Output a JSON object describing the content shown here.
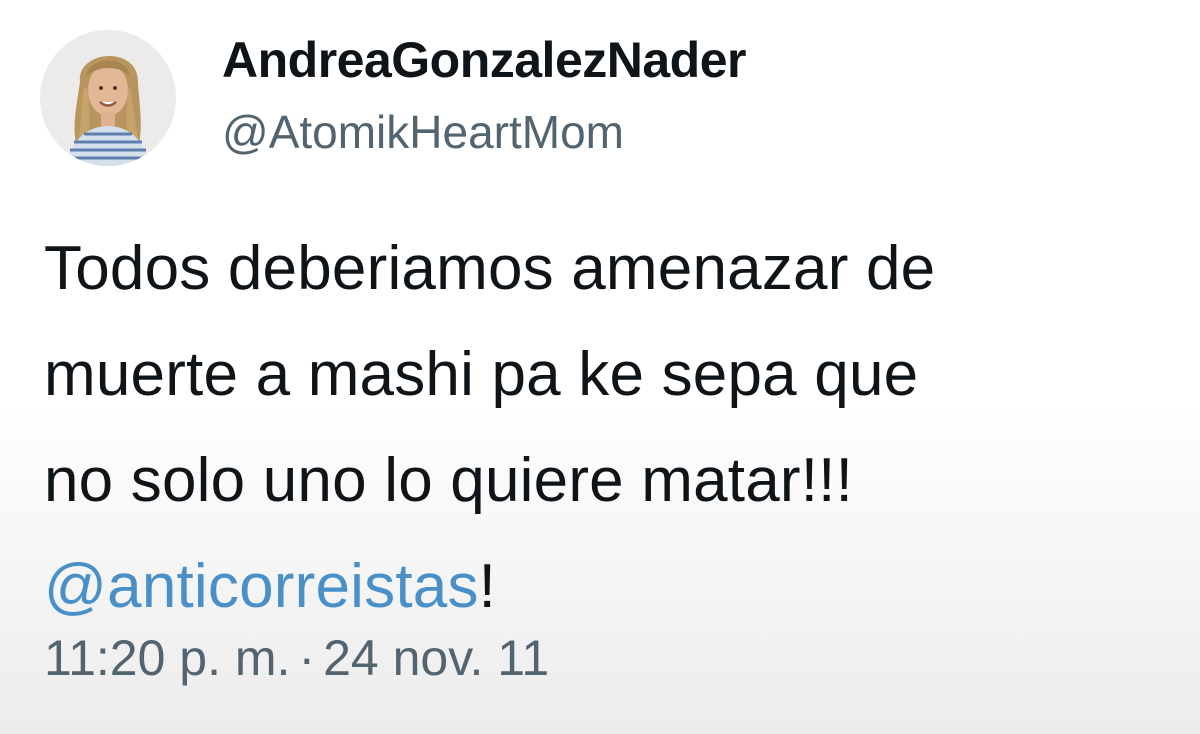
{
  "author": {
    "display_name": "AndreaGonzalezNader",
    "handle": "@AtomikHeartMom"
  },
  "tweet": {
    "lines": [
      "Todos deberiamos amenazar de",
      "muerte a mashi pa ke sepa que",
      "no solo uno lo quiere matar!!!"
    ],
    "mention": "@anticorreistas",
    "mention_suffix": "!",
    "time": "11:20 p. m.",
    "separator": "·",
    "date": "24 nov. 11"
  },
  "colors": {
    "mention": "#4a90c8",
    "secondary_text": "#536471",
    "primary_text": "#0f1419"
  }
}
